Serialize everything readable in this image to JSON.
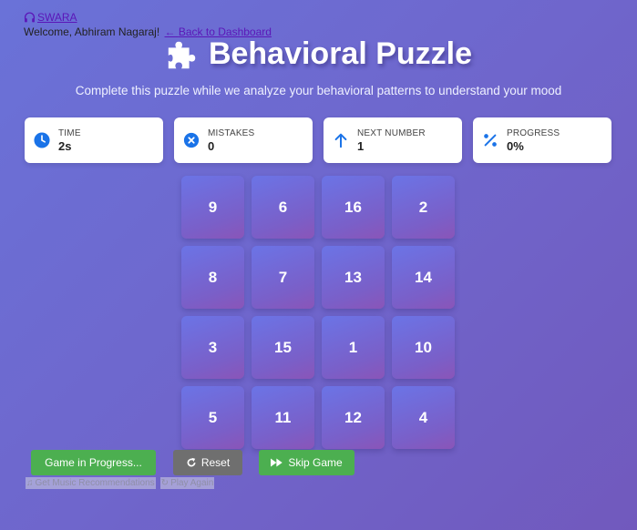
{
  "header": {
    "brand": "SWARA",
    "welcome": "Welcome, Abhiram Nagaraj!",
    "back_link": "Back to Dashboard"
  },
  "title": "Behavioral Puzzle",
  "subtitle": "Complete this puzzle while we analyze your behavioral patterns to understand your mood",
  "stats": {
    "time_label": "TIME",
    "time_value": "2s",
    "mistakes_label": "MISTAKES",
    "mistakes_value": "0",
    "next_label": "NEXT NUMBER",
    "next_value": "1",
    "progress_label": "PROGRESS",
    "progress_value": "0%"
  },
  "tiles": [
    "9",
    "6",
    "16",
    "2",
    "8",
    "7",
    "13",
    "14",
    "3",
    "15",
    "1",
    "10",
    "5",
    "11",
    "12",
    "4"
  ],
  "buttons": {
    "progress": "Game in Progress...",
    "reset": "Reset",
    "skip": "Skip Game",
    "music": "Get Music Recommendations",
    "play_again": "Play Again"
  },
  "colors": {
    "accent_blue": "#1a73e8",
    "green": "#4caf50",
    "grey": "#6f6f6f",
    "link": "#5b16b8"
  }
}
